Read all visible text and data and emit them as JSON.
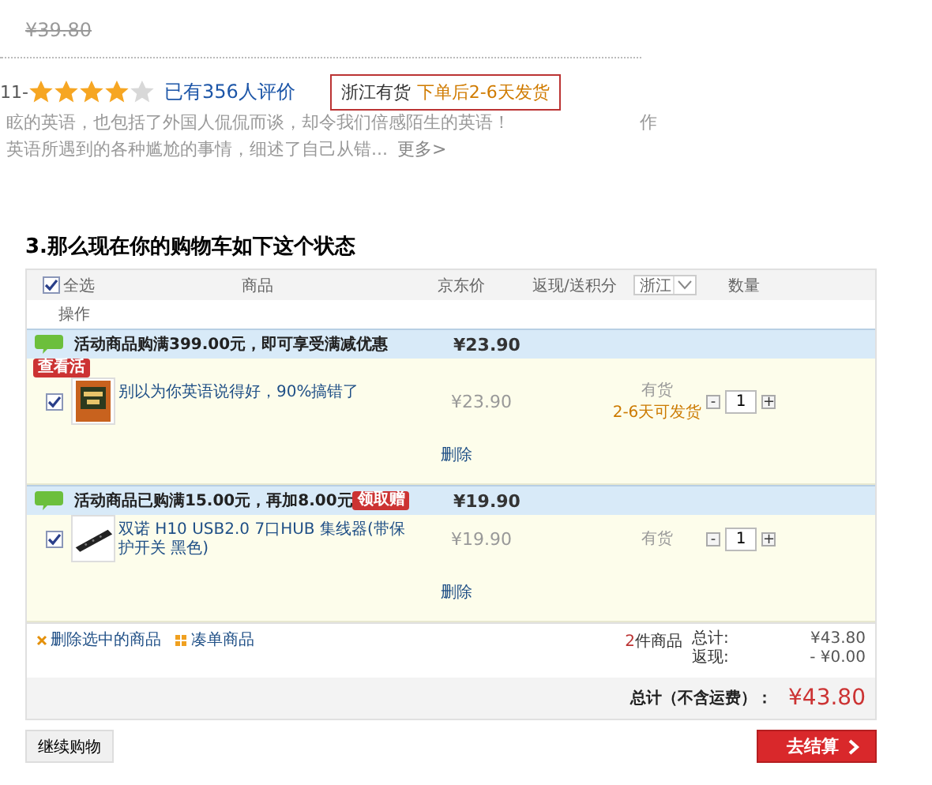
{
  "top": {
    "old_price": "¥39.80",
    "rating_prefix": "11-",
    "stars": 4,
    "review_count": "已有356人评价",
    "stock_region": "浙江有货",
    "stock_shipping": "下单后2-6天发货",
    "description": [
      {
        "text": "眩的英语，也包括了外国人侃侃而谈，却令我们倍感陌生的英语！",
        "tail": "作"
      },
      {
        "text": "英语所遇到的各种尴尬的事情，细述了自己从错...",
        "tail": "更多>"
      }
    ]
  },
  "heading": "3.那么现在你的购物车如下这个状态",
  "cart": {
    "select_all": {
      "label": "全选",
      "checked": true
    },
    "columns": [
      "商品",
      "京东价",
      "返现/送积分"
    ],
    "region_select": "浙江",
    "quantity_column": "数量",
    "action_column": "操作",
    "groups": [
      {
        "promo": "活动商品购满399.00元，即可享受满减优惠",
        "subtotal": "¥23.90",
        "badge": "查看活",
        "kind": "below",
        "items": [
          {
            "checked": true,
            "title": "别以为你英语说得好，90%搞错了",
            "price": "¥23.90",
            "stock": "有货",
            "shipping": "2-6天可发货",
            "minus": "-",
            "quantity": "1",
            "plus": "+",
            "delete": "删除",
            "kind": "book"
          }
        ]
      },
      {
        "promo": "活动商品已购满15.00元，再加8.00元",
        "subtotal": "¥19.90",
        "badge": "领取赠",
        "kind": "inline",
        "items": [
          {
            "checked": true,
            "title": "双诺 H10 USB2.0 7口HUB 集线器(带保护开关 黑色)",
            "price": "¥19.90",
            "stock": "有货",
            "minus": "-",
            "quantity": "1",
            "plus": "+",
            "delete": "删除",
            "kind": "hub"
          }
        ]
      }
    ],
    "footer": {
      "delete_selected": "删除选中的商品",
      "add_on": "凑单商品",
      "count": "2",
      "count_label": "件商品",
      "total_label": "总计:",
      "total": "¥43.80",
      "cashback_label": "返现:",
      "cashback": "- ¥0.00",
      "grand_label": "总计（不含运费）：",
      "grand_total": "¥43.80"
    }
  },
  "buttons": {
    "continue": "继续购物",
    "checkout": "去结算"
  }
}
